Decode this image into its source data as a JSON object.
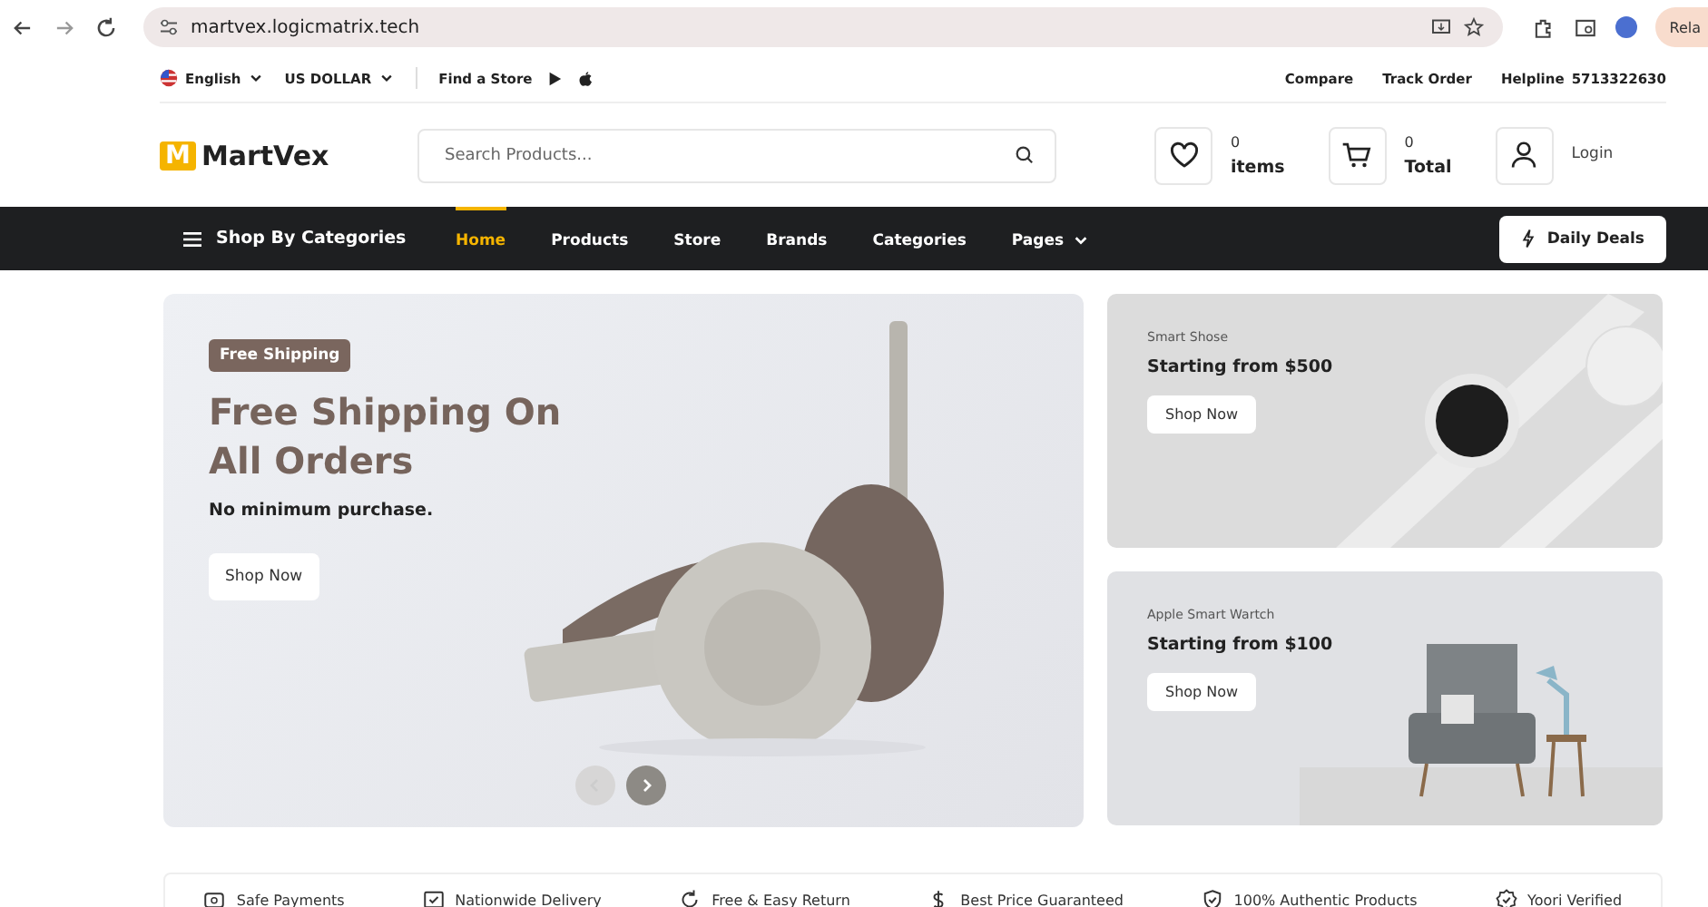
{
  "browser": {
    "url": "martvex.logicmatrix.tech",
    "profile_button": "Rela"
  },
  "topbar": {
    "language": "English",
    "currency": "US DOLLAR",
    "find_store": "Find a Store",
    "links": [
      "Compare",
      "Track Order"
    ],
    "helpline_label": "Helpline",
    "helpline_number": "5713322630"
  },
  "header": {
    "logo_mark": "M",
    "logo_text": "MartVex",
    "search": {
      "placeholder": "Search Products..."
    },
    "wishlist": {
      "count": "0",
      "label": "items"
    },
    "cart": {
      "count": "0",
      "label": "Total"
    },
    "login": "Login"
  },
  "nav": {
    "categories": "Shop By Categories",
    "items": [
      {
        "label": "Home",
        "selected": true,
        "dropdown": false
      },
      {
        "label": "Products",
        "selected": false,
        "dropdown": false
      },
      {
        "label": "Store",
        "selected": false,
        "dropdown": false
      },
      {
        "label": "Brands",
        "selected": false,
        "dropdown": false
      },
      {
        "label": "Categories",
        "selected": false,
        "dropdown": false
      },
      {
        "label": "Pages",
        "selected": false,
        "dropdown": true
      }
    ],
    "deals": "Daily Deals"
  },
  "hero": {
    "badge": "Free Shipping",
    "title": "Free Shipping On All Orders",
    "subtitle": "No minimum purchase.",
    "button": "Shop Now"
  },
  "promos": [
    {
      "kind": "watch",
      "label": "Smart Shose",
      "title": "Starting from $500",
      "button": "Shop Now"
    },
    {
      "kind": "chair",
      "label": "Apple Smart Wartch",
      "title": "Starting from $100",
      "button": "Shop Now"
    }
  ],
  "features": [
    {
      "kind": "payment",
      "label": "Safe Payments"
    },
    {
      "kind": "delivery",
      "label": "Nationwide Delivery"
    },
    {
      "kind": "return",
      "label": "Free & Easy Return"
    },
    {
      "kind": "price",
      "label": "Best Price Guaranteed"
    },
    {
      "kind": "authentic",
      "label": "100% Authentic Products"
    },
    {
      "kind": "verified",
      "label": "Yoori Verified"
    }
  ]
}
